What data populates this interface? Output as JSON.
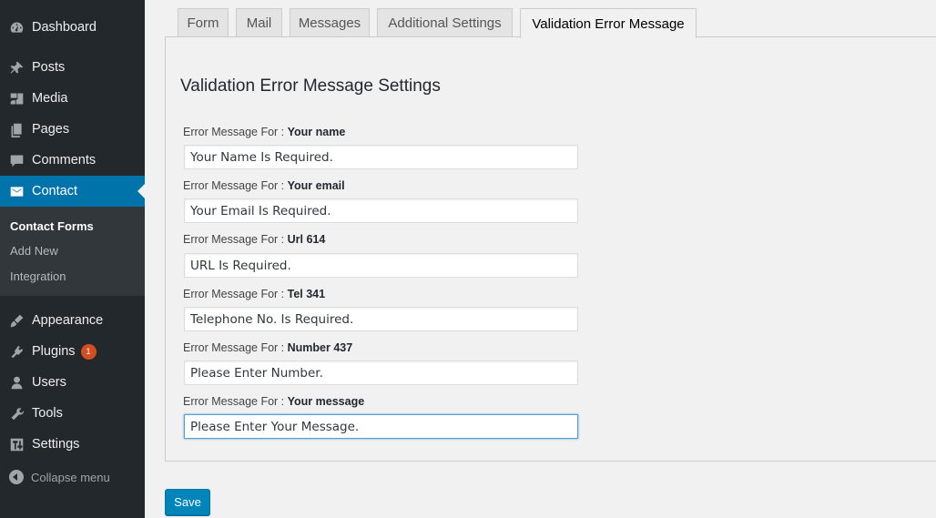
{
  "sidebar": {
    "items": [
      {
        "label": "Dashboard",
        "icon": "dashboard-icon"
      },
      {
        "label": "Posts",
        "icon": "pin-icon"
      },
      {
        "label": "Media",
        "icon": "media-icon"
      },
      {
        "label": "Pages",
        "icon": "pages-icon"
      },
      {
        "label": "Comments",
        "icon": "comments-icon"
      },
      {
        "label": "Contact",
        "icon": "mail-icon"
      },
      {
        "label": "Appearance",
        "icon": "brush-icon"
      },
      {
        "label": "Plugins",
        "icon": "plugin-icon",
        "badge": "1"
      },
      {
        "label": "Users",
        "icon": "user-icon"
      },
      {
        "label": "Tools",
        "icon": "wrench-icon"
      },
      {
        "label": "Settings",
        "icon": "settings-icon"
      }
    ],
    "submenu": [
      "Contact Forms",
      "Add New",
      "Integration"
    ],
    "collapse_label": "Collapse menu",
    "active_color": "#0073aa"
  },
  "tabs": [
    "Form",
    "Mail",
    "Messages",
    "Additional Settings",
    "Validation Error Message"
  ],
  "panel": {
    "title": "Validation Error Message Settings",
    "label_prefix": "Error Message For :",
    "fields": [
      {
        "name": "Your name",
        "value": "Your Name Is Required."
      },
      {
        "name": "Your email",
        "value": "Your Email Is Required."
      },
      {
        "name": "Url 614",
        "value": "URL Is Required."
      },
      {
        "name": "Tel 341",
        "value": "Telephone No. Is Required."
      },
      {
        "name": "Number 437",
        "value": "Please Enter Number."
      },
      {
        "name": "Your message",
        "value": "Please Enter Your Message."
      }
    ]
  },
  "save_label": "Save"
}
